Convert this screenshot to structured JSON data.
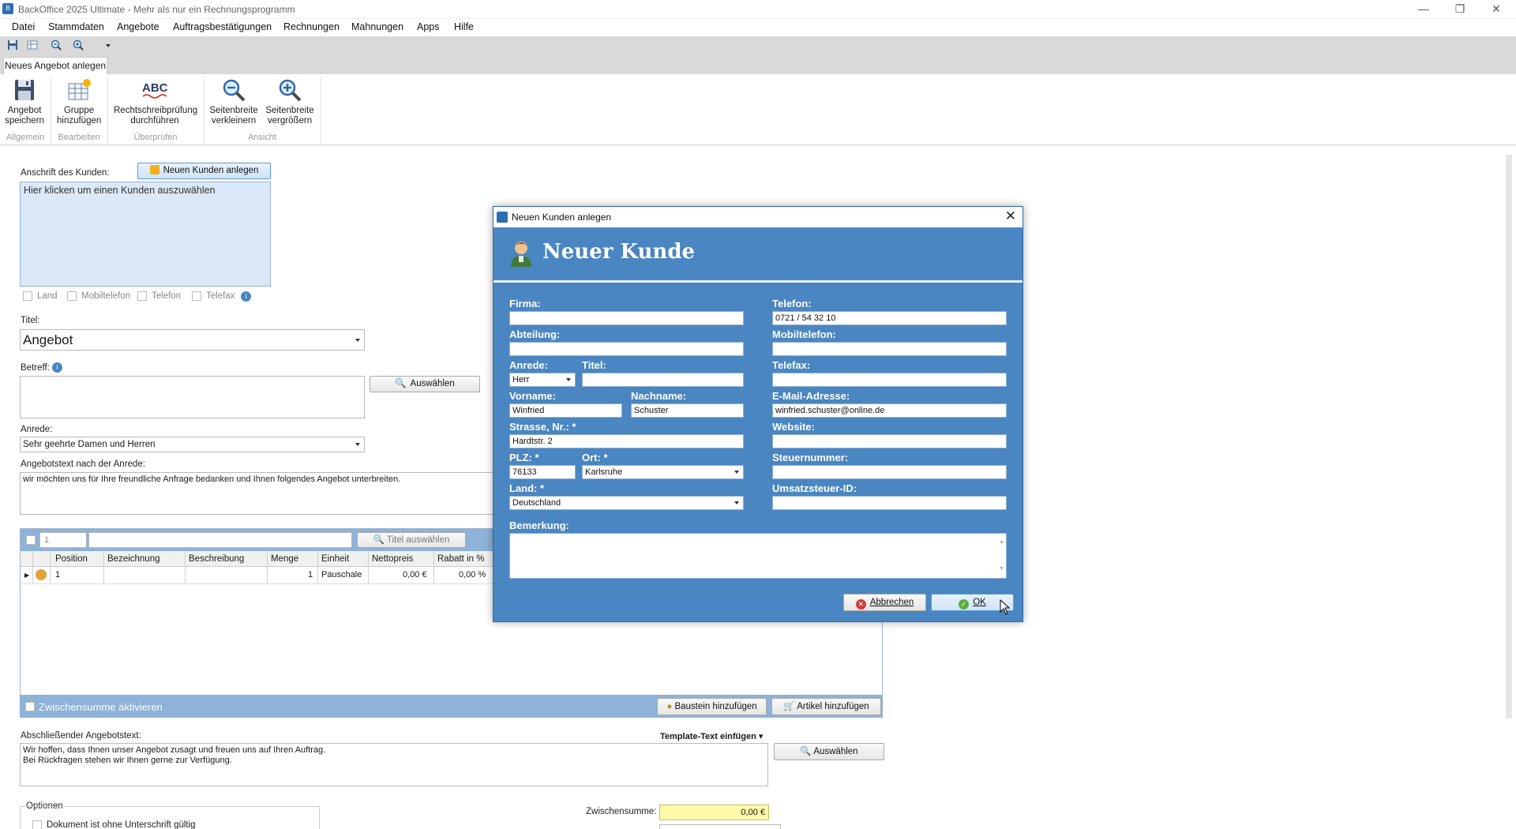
{
  "window": {
    "title": "BackOffice 2025 Ultimate - Mehr als nur ein Rechnungsprogramm",
    "minimize": "—",
    "maximize": "❐",
    "close": "✕"
  },
  "menu": [
    "Datei",
    "Stammdaten",
    "Angebote",
    "Auftragsbestätigungen",
    "Rechnungen",
    "Mahnungen",
    "Apps",
    "Hilfe"
  ],
  "ribbon": {
    "tab": "Neues Angebot anlegen",
    "buttons": {
      "save": [
        "Angebot",
        "speichern"
      ],
      "group": [
        "Gruppe",
        "hinzufügen"
      ],
      "spell": [
        "Rechtschreibprüfung",
        "durchführen"
      ],
      "zoom_out": [
        "Seitenbreite",
        "verkleinern"
      ],
      "zoom_in": [
        "Seitenbreite",
        "vergrößern"
      ]
    },
    "groups": [
      "Allgemein",
      "Bearbeiten",
      "Überprüfen",
      "Ansicht"
    ]
  },
  "form": {
    "customer_label": "Anschrift des Kunden:",
    "new_customer_button": "Neuen Kunden anlegen",
    "customer_placeholder": "Hier klicken um einen Kunden auszuwählen",
    "checks": [
      "Land",
      "Mobiltelefon",
      "Telefon",
      "Telefax"
    ],
    "title_label": "Titel:",
    "title_value": "Angebot",
    "subject_label": "Betreff:",
    "select_button": "Auswählen",
    "salutation_label": "Anrede:",
    "salutation_value": "Sehr geehrte Damen und Herren",
    "intro_label": "Angebotstext nach der Anrede:",
    "intro_text": "wir möchten uns für Ihre freundliche Anfrage bedanken und Ihnen folgendes Angebot unterbreiten.",
    "pos_number": "1",
    "title_select_button": "Titel auswählen",
    "grid_columns": [
      "Position",
      "Bezeichnung",
      "Beschreibung",
      "Menge",
      "Einheit",
      "Nettopreis",
      "Rabatt in %"
    ],
    "grid_row": {
      "position": "1",
      "menge": "1",
      "einheit": "Pauschale",
      "nettopreis": "0,00 €",
      "rabatt": "0,00 %"
    },
    "subtotal_toggle": "Zwischensumme aktivieren",
    "add_block_button": "Baustein hinzufügen",
    "add_article_button": "Artikel hinzufügen",
    "closing_label": "Abschließender Angebotstext:",
    "template_text_button": "Template-Text einfügen",
    "closing_text_1": "Wir hoffen, dass Ihnen unser Angebot zusagt und freuen uns auf Ihren Auftrag.",
    "closing_text_2": "Bei Rückfragen stehen wir Ihnen gerne zur Verfügung.",
    "options_label": "Optionen",
    "option_1": "Dokument ist ohne Unterschrift gültig",
    "subtotal_label": "Zwischensumme:",
    "subtotal_value": "0,00 €"
  },
  "dialog": {
    "title": "Neuen Kunden anlegen",
    "heading": "Neuer Kunde",
    "labels": {
      "firma": "Firma:",
      "abteilung": "Abteilung:",
      "anrede": "Anrede:",
      "titel": "Titel:",
      "vorname": "Vorname:",
      "nachname": "Nachname:",
      "strasse": "Strasse, Nr.: *",
      "plz": "PLZ: *",
      "ort": "Ort: *",
      "land": "Land: *",
      "telefon": "Telefon:",
      "mobil": "Mobiltelefon:",
      "telefax": "Telefax:",
      "email": "E-Mail-Adresse:",
      "website": "Website:",
      "steuernummer": "Steuernummer:",
      "ustid": "Umsatzsteuer-ID:",
      "bemerkung": "Bemerkung:"
    },
    "values": {
      "anrede": "Herr",
      "vorname": "Winfried",
      "nachname": "Schuster",
      "strasse": "Hardtstr. 2",
      "plz": "76133",
      "ort": "Karlsruhe",
      "land": "Deutschland",
      "telefon": "0721 / 54 32 10",
      "email": "winfried.schuster@online.de"
    },
    "cancel_button": "Abbrechen",
    "ok_button": "OK"
  }
}
